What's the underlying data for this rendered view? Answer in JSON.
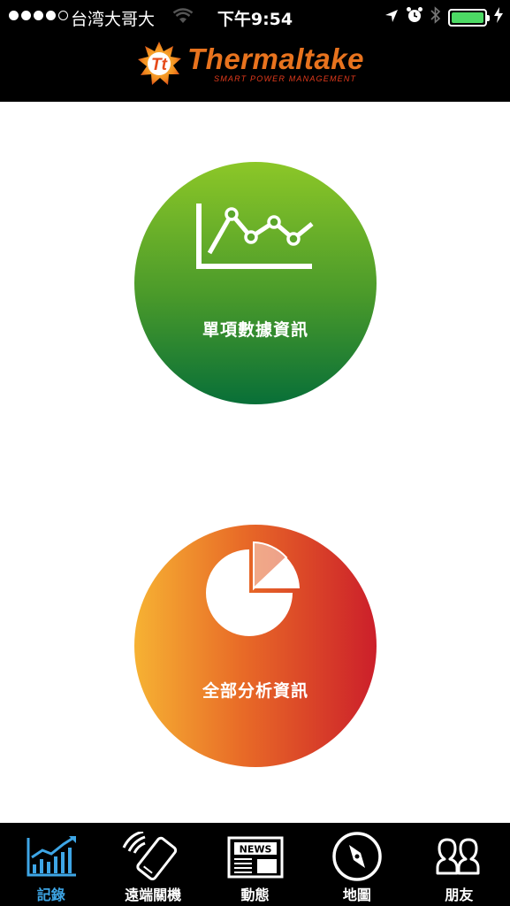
{
  "status_bar": {
    "carrier": "台湾大哥大",
    "time": "下午9:54",
    "signal_bars": 4,
    "battery_level": 1.0
  },
  "header": {
    "brand_name": "Thermaltake",
    "brand_tagline": "SMART POWER MANAGEMENT",
    "logo_text": "Tt"
  },
  "main": {
    "single_data": {
      "label": "單項數據資訊",
      "icon": "line-chart-icon"
    },
    "all_analysis": {
      "label": "全部分析資訊",
      "icon": "pie-chart-icon"
    }
  },
  "tabbar": {
    "active_index": 0,
    "active_color": "#3ea6e6",
    "items": [
      {
        "label": "記錄",
        "icon": "bar-chart-icon"
      },
      {
        "label": "遠端關機",
        "icon": "phone-remote-icon"
      },
      {
        "label": "動態",
        "icon": "newspaper-icon"
      },
      {
        "label": "地圖",
        "icon": "compass-icon"
      },
      {
        "label": "朋友",
        "icon": "friends-icon"
      }
    ]
  }
}
